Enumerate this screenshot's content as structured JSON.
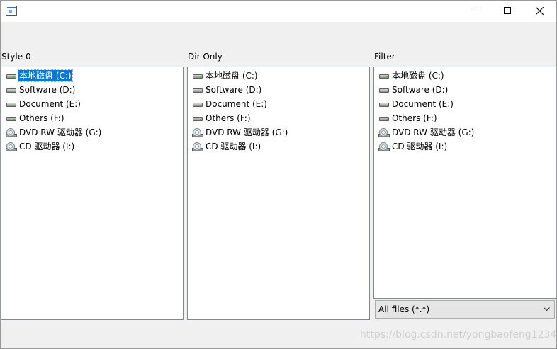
{
  "window": {
    "controls": {
      "minimize_icon": "minimize-icon",
      "maximize_icon": "maximize-icon",
      "close_icon": "close-icon"
    }
  },
  "columns": [
    {
      "label": "Style 0",
      "items": [
        {
          "label": "本地磁盘 (C:)",
          "icon": "hard-drive-icon",
          "selected": true
        },
        {
          "label": "Software (D:)",
          "icon": "hard-drive-icon"
        },
        {
          "label": "Document (E:)",
          "icon": "hard-drive-icon"
        },
        {
          "label": "Others (F:)",
          "icon": "hard-drive-icon"
        },
        {
          "label": "DVD RW 驱动器 (G:)",
          "icon": "optical-drive-icon"
        },
        {
          "label": "CD 驱动器 (I:)",
          "icon": "optical-drive-icon"
        }
      ]
    },
    {
      "label": "Dir Only",
      "items": [
        {
          "label": "本地磁盘 (C:)",
          "icon": "hard-drive-icon"
        },
        {
          "label": "Software (D:)",
          "icon": "hard-drive-icon"
        },
        {
          "label": "Document (E:)",
          "icon": "hard-drive-icon"
        },
        {
          "label": "Others (F:)",
          "icon": "hard-drive-icon"
        },
        {
          "label": "DVD RW 驱动器 (G:)",
          "icon": "optical-drive-icon"
        },
        {
          "label": "CD 驱动器 (I:)",
          "icon": "optical-drive-icon"
        }
      ]
    },
    {
      "label": "Filter",
      "items": [
        {
          "label": "本地磁盘 (C:)",
          "icon": "hard-drive-icon"
        },
        {
          "label": "Software (D:)",
          "icon": "hard-drive-icon"
        },
        {
          "label": "Document (E:)",
          "icon": "hard-drive-icon"
        },
        {
          "label": "Others (F:)",
          "icon": "hard-drive-icon"
        },
        {
          "label": "DVD RW 驱动器 (G:)",
          "icon": "optical-drive-icon"
        },
        {
          "label": "CD 驱动器 (I:)",
          "icon": "optical-drive-icon"
        }
      ]
    }
  ],
  "filter": {
    "selected": "All files (*.*)"
  },
  "watermark": "https://blog.csdn.net/yongbaofeng1234",
  "colors": {
    "selection": "#0078d7",
    "panel_border": "#828790",
    "background": "#f0f0f0"
  }
}
